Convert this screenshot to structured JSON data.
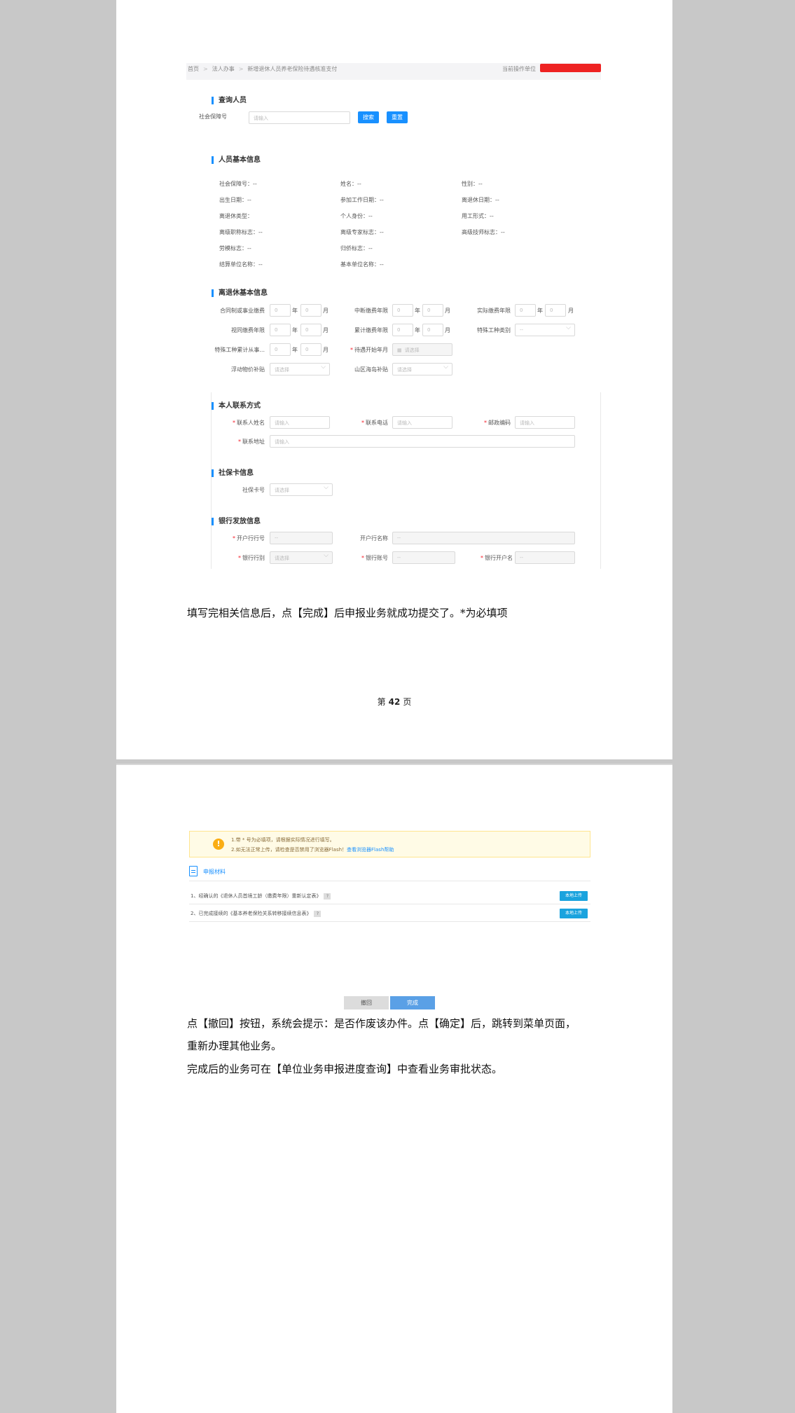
{
  "page1": {
    "screenshot": {
      "breadcrumb": [
        "首页",
        "法人办事",
        "新增退休人员养老保险待遇核准支付"
      ],
      "current_unit_label": "当前操作单位",
      "query": {
        "title": "查询人员",
        "ssn_label": "社会保障号",
        "ssn_placeholder": "请输入",
        "search_label": "搜索",
        "reset_label": "重置"
      },
      "basic_info": {
        "title": "人员基本信息",
        "fields": [
          [
            "社会保障号：--",
            "姓名：--",
            "性别：--"
          ],
          [
            "出生日期：--",
            "参加工作日期：--",
            "离退休日期：--"
          ],
          [
            "离退休类型：",
            "个人身份：--",
            "用工形式：--"
          ],
          [
            "离级职称标志：--",
            "离级专家标志：--",
            "高级技师标志：--"
          ],
          [
            "劳模标志：--",
            "归侨标志：--",
            ""
          ],
          [
            "结算单位名称：--",
            "基本单位名称：--",
            ""
          ]
        ]
      },
      "retire_info": {
        "title": "离退休基本信息",
        "zero": "0",
        "year": "年",
        "month": "月",
        "contract_label": "合同制或事业缴费",
        "interrupt_label": "中断缴费年限",
        "actual_label": "实际缴费年限",
        "deemed_label": "视同缴费年限",
        "cumulative_label": "累计缴费年限",
        "special_type_label": "特殊工种类别",
        "special_years_label": "特殊工种累计从事...",
        "start_month_label": "待遇开始年月",
        "price_subsidy_label": "浮动物价补贴",
        "mountain_subsidy_label": "山区海岛补贴",
        "select_placeholder": "请选择",
        "date_placeholder": "请选择",
        "dash_placeholder": "--"
      },
      "contact": {
        "title": "本人联系方式",
        "name_label": "联系人姓名",
        "phone_label": "联系电话",
        "zip_label": "邮政编码",
        "address_label": "联系地址",
        "input_placeholder": "请输入"
      },
      "card": {
        "title": "社保卡信息",
        "card_label": "社保卡号",
        "select_placeholder": "请选择"
      },
      "bank": {
        "title": "银行发放信息",
        "bank_code_label": "开户行行号",
        "bank_name_label": "开户行名称",
        "bank_type_label": "银行行别",
        "account_label": "银行账号",
        "account_name_label": "银行开户名",
        "select_placeholder": "请选择",
        "dash_placeholder": "--"
      }
    },
    "instruction": "填写完相关信息后，点【完成】后申报业务就成功提交了。*为必填项",
    "page_prefix": "第",
    "page_number": "42",
    "page_suffix": "页"
  },
  "page2": {
    "screenshot": {
      "warning_line1": "1.带 * 号为必填项，请根据实际情况进行填写。",
      "warning_line2_prefix": "2.如无法正常上传，请检查是否禁用了浏览器Flash！",
      "warning_link": "查看浏览器Flash帮助",
      "materials_title": "申报材料",
      "materials": [
        {
          "text": "1、经确认的《退休人员首境工龄（缴费年限）重新认定表》",
          "button": "本地上传"
        },
        {
          "text": "2、已完成接续的《基本养老保险关系转移接续信息表》",
          "button": "本地上传"
        }
      ],
      "back_label": "撤回",
      "done_label": "完成"
    },
    "para1": "点【撤回】按钮，系统会提示：是否作废该办件。点【确定】后，跳转到菜单页面，",
    "para2": "重新办理其他业务。",
    "para3": " 完成后的业务可在【单位业务申报进度查询】中查看业务审批状态。"
  },
  "colors": {
    "primary": "#1890ff",
    "redacted": "#ee2222",
    "warning_bg": "#fffbe6",
    "upload": "#1aa3de"
  }
}
